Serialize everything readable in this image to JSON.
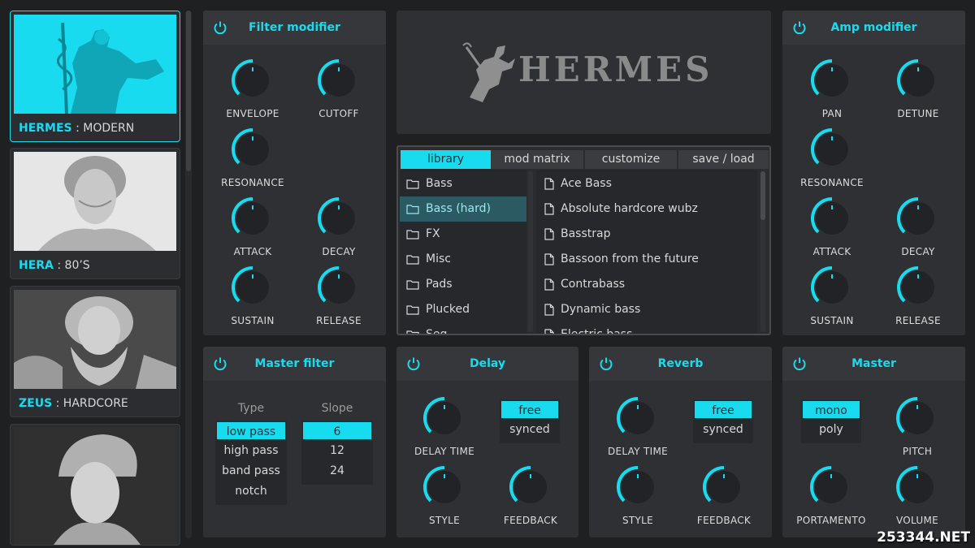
{
  "presets": [
    {
      "name": "HERMES",
      "style": "MODERN",
      "active": true
    },
    {
      "name": "HERA",
      "style": "80’S",
      "active": false
    },
    {
      "name": "ZEUS",
      "style": "HARDCORE",
      "active": false
    },
    {
      "name": "",
      "style": "",
      "active": false
    }
  ],
  "filter_modifier": {
    "title": "Filter modifier",
    "knobs": [
      {
        "label": "ENVELOPE",
        "value": 0.5
      },
      {
        "label": "CUTOFF",
        "value": 0.5
      },
      {
        "label": "RESONANCE",
        "value": 0.5
      },
      {
        "label": "ATTACK",
        "value": 0.5
      },
      {
        "label": "DECAY",
        "value": 0.5
      },
      {
        "label": "SUSTAIN",
        "value": 0.5
      },
      {
        "label": "RELEASE",
        "value": 0.5
      }
    ]
  },
  "logo": {
    "text": "HERMES"
  },
  "browser": {
    "tabs": [
      "library",
      "mod matrix",
      "customize",
      "save / load"
    ],
    "selected_tab": "library",
    "folders": [
      "Bass",
      "Bass (hard)",
      "FX",
      "Misc",
      "Pads",
      "Plucked",
      "Seq"
    ],
    "selected_folder": "Bass (hard)",
    "files": [
      "Ace Bass",
      "Absolute hardcore wubz",
      "Basstrap",
      "Bassoon from the future",
      "Contrabass",
      "Dynamic bass",
      "Electric bass"
    ]
  },
  "amp_modifier": {
    "title": "Amp modifier",
    "knobs": [
      {
        "label": "PAN",
        "value": 0.5
      },
      {
        "label": "DETUNE",
        "value": 0.5
      },
      {
        "label": "RESONANCE",
        "value": 0.5
      },
      {
        "label": "ATTACK",
        "value": 0.5
      },
      {
        "label": "DECAY",
        "value": 0.5
      },
      {
        "label": "SUSTAIN",
        "value": 0.5
      },
      {
        "label": "RELEASE",
        "value": 0.5
      }
    ]
  },
  "master_filter": {
    "title": "Master filter",
    "type_label": "Type",
    "slope_label": "Slope",
    "types": [
      "low pass",
      "high pass",
      "band pass",
      "notch"
    ],
    "selected_type": "low pass",
    "slopes": [
      "6",
      "12",
      "24"
    ],
    "selected_slope": "6"
  },
  "delay": {
    "title": "Delay",
    "modes": [
      "free",
      "synced"
    ],
    "selected_mode": "free",
    "knobs": [
      {
        "label": "DELAY TIME",
        "value": 0.5
      },
      {
        "label": "STYLE",
        "value": 0.5
      },
      {
        "label": "FEEDBACK",
        "value": 0.5
      }
    ]
  },
  "reverb": {
    "title": "Reverb",
    "modes": [
      "free",
      "synced"
    ],
    "selected_mode": "free",
    "knobs": [
      {
        "label": "DELAY TIME",
        "value": 0.5
      },
      {
        "label": "STYLE",
        "value": 0.5
      },
      {
        "label": "FEEDBACK",
        "value": 0.5
      }
    ]
  },
  "master": {
    "title": "Master",
    "modes": [
      "mono",
      "poly"
    ],
    "selected_mode": "mono",
    "knobs": [
      {
        "label": "PITCH",
        "value": 0.5
      },
      {
        "label": "PORTAMENTO",
        "value": 0.5
      },
      {
        "label": "VOLUME",
        "value": 0.5
      }
    ]
  },
  "watermark": "253344.NET",
  "colors": {
    "accent": "#19dbf0",
    "panel": "#2f3033",
    "background": "#1f2022"
  }
}
